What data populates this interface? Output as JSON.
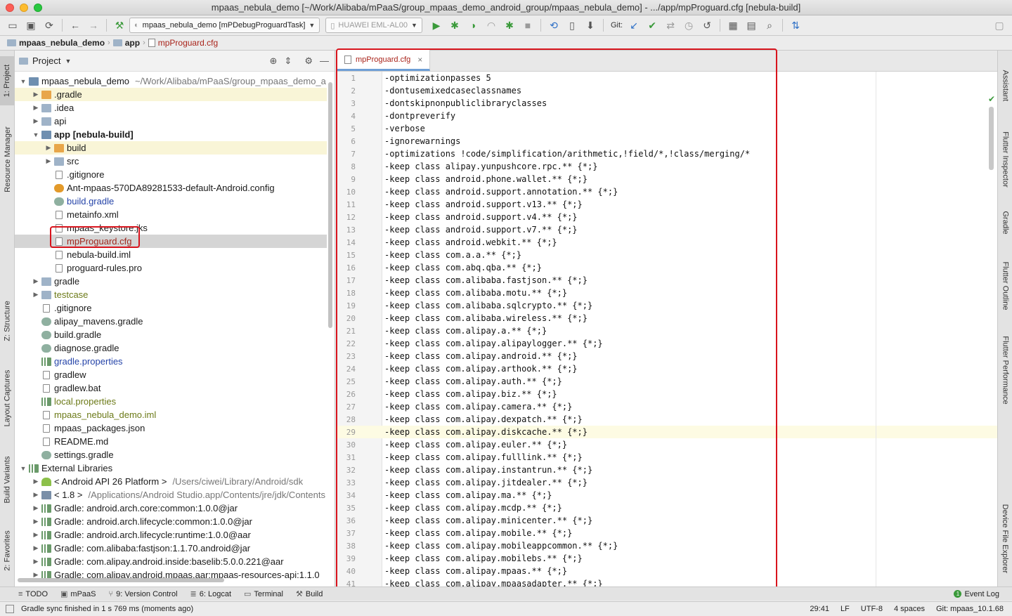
{
  "window": {
    "title": "mpaas_nebula_demo [~/Work/Alibaba/mPaaS/group_mpaas_demo_android_group/mpaas_nebula_demo] - .../app/mpProguard.cfg [nebula-build]"
  },
  "toolbar": {
    "run_config": "mpaas_nebula_demo [mPDebugProguardTask]",
    "device": "HUAWEI EML-AL00",
    "git_label": "Git:"
  },
  "breadcrumb": [
    "mpaas_nebula_demo",
    "app",
    "mpProguard.cfg"
  ],
  "left_stripe": [
    "1: Project",
    "Resource Manager",
    "Z: Structure",
    "Layout Captures",
    "Build Variants",
    "2: Favorites"
  ],
  "right_stripe": [
    "Assistant",
    "Flutter Inspector",
    "Gradle",
    "Flutter Outline",
    "Flutter Performance",
    "Device File Explorer"
  ],
  "project_panel": {
    "title": "Project",
    "tree": [
      {
        "label": "mpaas_nebula_demo",
        "suffix": "~/Work/Alibaba/mPaaS/group_mpaas_demo_a",
        "depth": 0,
        "arrow": "▼",
        "icon": "module",
        "style": "",
        "row": ""
      },
      {
        "label": ".gradle",
        "suffix": "",
        "depth": 1,
        "arrow": "▶",
        "icon": "folder-orange",
        "style": "",
        "row": "hl"
      },
      {
        "label": ".idea",
        "suffix": "",
        "depth": 1,
        "arrow": "▶",
        "icon": "folder",
        "style": "",
        "row": ""
      },
      {
        "label": "api",
        "suffix": "",
        "depth": 1,
        "arrow": "▶",
        "icon": "folder",
        "style": "",
        "row": ""
      },
      {
        "label": "app [nebula-build]",
        "suffix": "",
        "depth": 1,
        "arrow": "▼",
        "icon": "module",
        "style": "t-bold",
        "row": ""
      },
      {
        "label": "build",
        "suffix": "",
        "depth": 2,
        "arrow": "▶",
        "icon": "folder-orange",
        "style": "",
        "row": "hl"
      },
      {
        "label": "src",
        "suffix": "",
        "depth": 2,
        "arrow": "▶",
        "icon": "folder",
        "style": "",
        "row": ""
      },
      {
        "label": ".gitignore",
        "suffix": "",
        "depth": 2,
        "arrow": "",
        "icon": "file",
        "style": "",
        "row": ""
      },
      {
        "label": "Ant-mpaas-570DA89281533-default-Android.config",
        "suffix": "",
        "depth": 2,
        "arrow": "",
        "icon": "config",
        "style": "",
        "row": ""
      },
      {
        "label": "build.gradle",
        "suffix": "",
        "depth": 2,
        "arrow": "",
        "icon": "gradle",
        "style": "t-blue",
        "row": ""
      },
      {
        "label": "metainfo.xml",
        "suffix": "",
        "depth": 2,
        "arrow": "",
        "icon": "file",
        "style": "",
        "row": ""
      },
      {
        "label": "mpaas_keystore.jks",
        "suffix": "",
        "depth": 2,
        "arrow": "",
        "icon": "file",
        "style": "",
        "row": ""
      },
      {
        "label": "mpProguard.cfg",
        "suffix": "",
        "depth": 2,
        "arrow": "",
        "icon": "file",
        "style": "t-red",
        "row": "sel"
      },
      {
        "label": "nebula-build.iml",
        "suffix": "",
        "depth": 2,
        "arrow": "",
        "icon": "file",
        "style": "",
        "row": ""
      },
      {
        "label": "proguard-rules.pro",
        "suffix": "",
        "depth": 2,
        "arrow": "",
        "icon": "file",
        "style": "",
        "row": ""
      },
      {
        "label": "gradle",
        "suffix": "",
        "depth": 1,
        "arrow": "▶",
        "icon": "folder",
        "style": "",
        "row": ""
      },
      {
        "label": "testcase",
        "suffix": "",
        "depth": 1,
        "arrow": "▶",
        "icon": "folder",
        "style": "t-olive",
        "row": ""
      },
      {
        "label": ".gitignore",
        "suffix": "",
        "depth": 1,
        "arrow": "",
        "icon": "file",
        "style": "",
        "row": ""
      },
      {
        "label": "alipay_mavens.gradle",
        "suffix": "",
        "depth": 1,
        "arrow": "",
        "icon": "gradle",
        "style": "",
        "row": ""
      },
      {
        "label": "build.gradle",
        "suffix": "",
        "depth": 1,
        "arrow": "",
        "icon": "gradle",
        "style": "",
        "row": ""
      },
      {
        "label": "diagnose.gradle",
        "suffix": "",
        "depth": 1,
        "arrow": "",
        "icon": "gradle",
        "style": "",
        "row": ""
      },
      {
        "label": "gradle.properties",
        "suffix": "",
        "depth": 1,
        "arrow": "",
        "icon": "lib",
        "style": "t-blue",
        "row": ""
      },
      {
        "label": "gradlew",
        "suffix": "",
        "depth": 1,
        "arrow": "",
        "icon": "file",
        "style": "",
        "row": ""
      },
      {
        "label": "gradlew.bat",
        "suffix": "",
        "depth": 1,
        "arrow": "",
        "icon": "file",
        "style": "",
        "row": ""
      },
      {
        "label": "local.properties",
        "suffix": "",
        "depth": 1,
        "arrow": "",
        "icon": "lib",
        "style": "t-olive",
        "row": ""
      },
      {
        "label": "mpaas_nebula_demo.iml",
        "suffix": "",
        "depth": 1,
        "arrow": "",
        "icon": "file",
        "style": "t-olive",
        "row": ""
      },
      {
        "label": "mpaas_packages.json",
        "suffix": "",
        "depth": 1,
        "arrow": "",
        "icon": "file",
        "style": "",
        "row": ""
      },
      {
        "label": "README.md",
        "suffix": "",
        "depth": 1,
        "arrow": "",
        "icon": "file",
        "style": "",
        "row": ""
      },
      {
        "label": "settings.gradle",
        "suffix": "",
        "depth": 1,
        "arrow": "",
        "icon": "gradle",
        "style": "",
        "row": ""
      },
      {
        "label": "External Libraries",
        "suffix": "",
        "depth": 0,
        "arrow": "▼",
        "icon": "lib",
        "style": "",
        "row": ""
      },
      {
        "label": "< Android API 26 Platform >",
        "suffix": "/Users/ciwei/Library/Android/sdk",
        "depth": 1,
        "arrow": "▶",
        "icon": "android",
        "style": "",
        "row": ""
      },
      {
        "label": "< 1.8 >",
        "suffix": "/Applications/Android Studio.app/Contents/jre/jdk/Contents",
        "depth": 1,
        "arrow": "▶",
        "icon": "jdk",
        "style": "",
        "row": ""
      },
      {
        "label": "Gradle: android.arch.core:common:1.0.0@jar",
        "suffix": "",
        "depth": 1,
        "arrow": "▶",
        "icon": "lib",
        "style": "",
        "row": ""
      },
      {
        "label": "Gradle: android.arch.lifecycle:common:1.0.0@jar",
        "suffix": "",
        "depth": 1,
        "arrow": "▶",
        "icon": "lib",
        "style": "",
        "row": ""
      },
      {
        "label": "Gradle: android.arch.lifecycle:runtime:1.0.0@aar",
        "suffix": "",
        "depth": 1,
        "arrow": "▶",
        "icon": "lib",
        "style": "",
        "row": ""
      },
      {
        "label": "Gradle: com.alibaba:fastjson:1.1.70.android@jar",
        "suffix": "",
        "depth": 1,
        "arrow": "▶",
        "icon": "lib",
        "style": "",
        "row": ""
      },
      {
        "label": "Gradle: com.alipay.android.inside:baselib:5.0.0.221@aar",
        "suffix": "",
        "depth": 1,
        "arrow": "▶",
        "icon": "lib",
        "style": "",
        "row": ""
      },
      {
        "label": "Gradle: com.alipay.android.mpaas.aar:mpaas-resources-api:1.1.0",
        "suffix": "",
        "depth": 1,
        "arrow": "▶",
        "icon": "lib",
        "style": "",
        "row": ""
      }
    ]
  },
  "editor": {
    "tab_label": "mpProguard.cfg",
    "current_line": 29,
    "lines": [
      "-optimizationpasses 5",
      "-dontusemixedcaseclassnames",
      "-dontskipnonpubliclibraryclasses",
      "-dontpreverify",
      "-verbose",
      "-ignorewarnings",
      "-optimizations !code/simplification/arithmetic,!field/*,!class/merging/*",
      "-keep class alipay.yunpushcore.rpc.** {*;}",
      "-keep class android.phone.wallet.** {*;}",
      "-keep class android.support.annotation.** {*;}",
      "-keep class android.support.v13.** {*;}",
      "-keep class android.support.v4.** {*;}",
      "-keep class android.support.v7.** {*;}",
      "-keep class android.webkit.** {*;}",
      "-keep class com.a.a.** {*;}",
      "-keep class com.abq.qba.** {*;}",
      "-keep class com.alibaba.fastjson.** {*;}",
      "-keep class com.alibaba.motu.** {*;}",
      "-keep class com.alibaba.sqlcrypto.** {*;}",
      "-keep class com.alibaba.wireless.** {*;}",
      "-keep class com.alipay.a.** {*;}",
      "-keep class com.alipay.alipaylogger.** {*;}",
      "-keep class com.alipay.android.** {*;}",
      "-keep class com.alipay.arthook.** {*;}",
      "-keep class com.alipay.auth.** {*;}",
      "-keep class com.alipay.biz.** {*;}",
      "-keep class com.alipay.camera.** {*;}",
      "-keep class com.alipay.dexpatch.** {*;}",
      "-keep class com.alipay.diskcache.** {*;}",
      "-keep class com.alipay.euler.** {*;}",
      "-keep class com.alipay.fulllink.** {*;}",
      "-keep class com.alipay.instantrun.** {*;}",
      "-keep class com.alipay.jitdealer.** {*;}",
      "-keep class com.alipay.ma.** {*;}",
      "-keep class com.alipay.mcdp.** {*;}",
      "-keep class com.alipay.minicenter.** {*;}",
      "-keep class com.alipay.mobile.** {*;}",
      "-keep class com.alipay.mobileappcommon.** {*;}",
      "-keep class com.alipay.mobilebs.** {*;}",
      "-keep class com.alipay.mpaas.** {*;}",
      "-keep class com.alipay.mpaasadapter.** {*;}"
    ]
  },
  "bottom_tools": [
    {
      "label": "TODO",
      "icon": "≡"
    },
    {
      "label": "mPaaS",
      "icon": "▣"
    },
    {
      "label": "9: Version Control",
      "icon": "⑂"
    },
    {
      "label": "6: Logcat",
      "icon": "≣"
    },
    {
      "label": "Terminal",
      "icon": "▭"
    },
    {
      "label": "Build",
      "icon": "⚒"
    }
  ],
  "event_log": {
    "label": "Event Log",
    "count": "1"
  },
  "status": {
    "message": "Gradle sync finished in 1 s 769 ms (moments ago)",
    "position": "29:41",
    "line_sep": "LF",
    "encoding": "UTF-8",
    "indent": "4 spaces",
    "git_branch": "Git: mpaas_10.1.68"
  }
}
